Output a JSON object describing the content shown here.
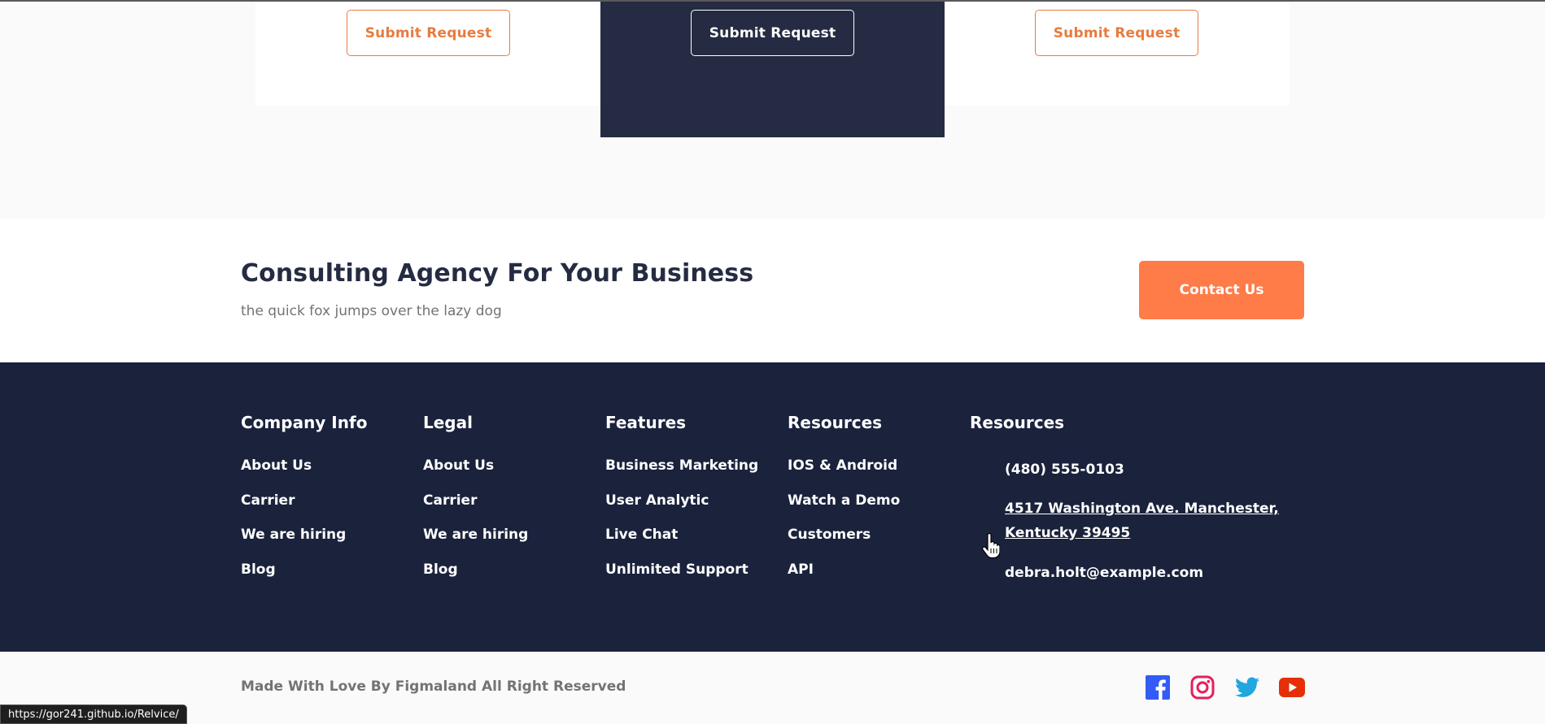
{
  "pricing": {
    "buttons": [
      "Submit Request",
      "Submit Request",
      "Submit Request"
    ]
  },
  "cta": {
    "title": "Consulting Agency For Your Business",
    "subtitle": "the quick fox jumps over the lazy dog",
    "button": "Contact Us"
  },
  "footer": {
    "columns": [
      {
        "title": "Company Info",
        "links": [
          "About Us",
          "Carrier",
          "We are hiring",
          "Blog"
        ]
      },
      {
        "title": "Legal",
        "links": [
          "About Us",
          "Carrier",
          "We are hiring",
          "Blog"
        ]
      },
      {
        "title": "Features",
        "links": [
          "Business Marketing",
          "User Analytic",
          "Live Chat",
          "Unlimited Support"
        ]
      },
      {
        "title": "Resources",
        "links": [
          "IOS & Android",
          "Watch a Demo",
          "Customers",
          "API"
        ]
      },
      {
        "title": "Resources"
      }
    ],
    "contact": {
      "phone": "(480) 555-0103",
      "address_line1": "4517 Washington Ave. Manchester,",
      "address_line2": "Kentucky 39495",
      "email": "debra.holt@example.com"
    }
  },
  "bottom": {
    "copyright": "Made With Love By Figmaland All Right Reserved",
    "social": [
      "facebook-icon",
      "instagram-icon",
      "twitter-icon",
      "youtube-icon"
    ]
  },
  "status_bar": {
    "url": "https://gor241.github.io/Relvice/"
  },
  "colors": {
    "accent": "#e77c40",
    "cta_button": "#ff7b47",
    "dark_navy": "#252b42",
    "footer_bg": "#1a223c",
    "facebook": "#335bf5",
    "instagram": "#e51f5a",
    "twitter": "#21a6df",
    "youtube": "#e42f08"
  }
}
